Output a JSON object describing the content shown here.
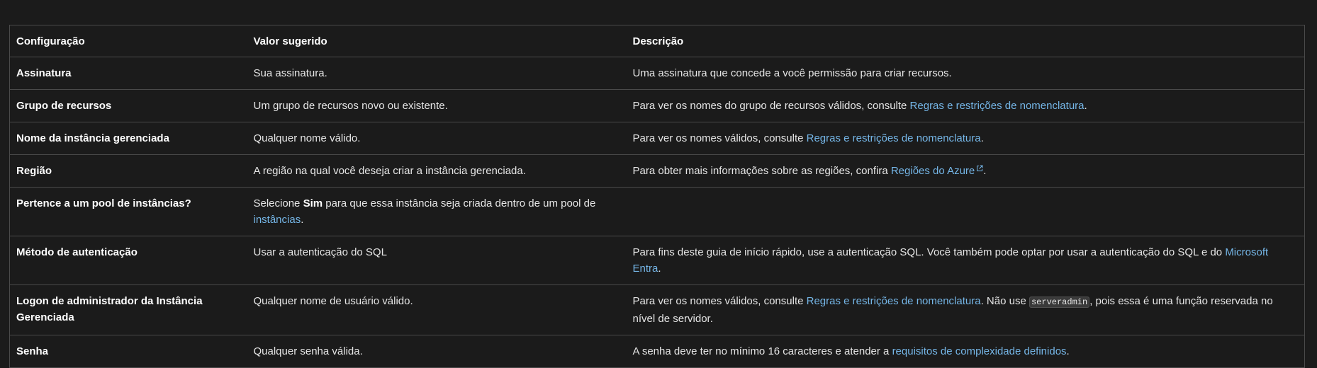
{
  "table": {
    "headers": {
      "setting": "Configuração",
      "suggested_value": "Valor sugerido",
      "description": "Descrição"
    },
    "rows": [
      {
        "setting": "Assinatura",
        "value": "Sua assinatura.",
        "desc_text": "Uma assinatura que concede a você permissão para criar recursos."
      },
      {
        "setting": "Grupo de recursos",
        "value": "Um grupo de recursos novo ou existente.",
        "desc_before": "Para ver os nomes do grupo de recursos válidos, consulte ",
        "desc_link": "Regras e restrições de nomenclatura",
        "desc_after": "."
      },
      {
        "setting": "Nome da instância gerenciada",
        "value": "Qualquer nome válido.",
        "desc_before": "Para ver os nomes válidos, consulte ",
        "desc_link": "Regras e restrições de nomenclatura",
        "desc_after": "."
      },
      {
        "setting": "Região",
        "value": "A região na qual você deseja criar a instância gerenciada.",
        "desc_before": "Para obter mais informações sobre as regiões, confira ",
        "desc_link": "Regiões do Azure",
        "desc_after": "."
      },
      {
        "setting": "Pertence a um pool de instâncias?",
        "value_before": "Selecione ",
        "value_bold": "Sim",
        "value_middle": " para que essa instância seja criada dentro de um pool de ",
        "value_link": "instâncias",
        "value_after": ".",
        "desc_text": ""
      },
      {
        "setting": "Método de autenticação",
        "value": "Usar a autenticação do SQL",
        "desc_before": "Para fins deste guia de início rápido, use a autenticação SQL. Você também pode optar por usar a autenticação do SQL e do ",
        "desc_link": "Microsoft Entra",
        "desc_after": "."
      },
      {
        "setting": "Logon de administrador da Instância Gerenciada",
        "value": "Qualquer nome de usuário válido.",
        "desc_before": "Para ver os nomes válidos, consulte ",
        "desc_link": "Regras e restrições de nomenclatura",
        "desc_middle": ". Não use ",
        "desc_code": "serveradmin",
        "desc_after": ", pois essa é uma função reservada no nível de servidor."
      },
      {
        "setting": "Senha",
        "value": "Qualquer senha válida.",
        "desc_before": "A senha deve ter no mínimo 16 caracteres e atender a ",
        "desc_link": "requisitos de complexidade definidos",
        "desc_after": "."
      }
    ]
  },
  "icons": {
    "external_link": "external-link-icon"
  },
  "colors": {
    "background": "#1b1b1b",
    "border": "#4a4a4a",
    "link": "#75b6e7",
    "text": "#e6e6e6"
  }
}
